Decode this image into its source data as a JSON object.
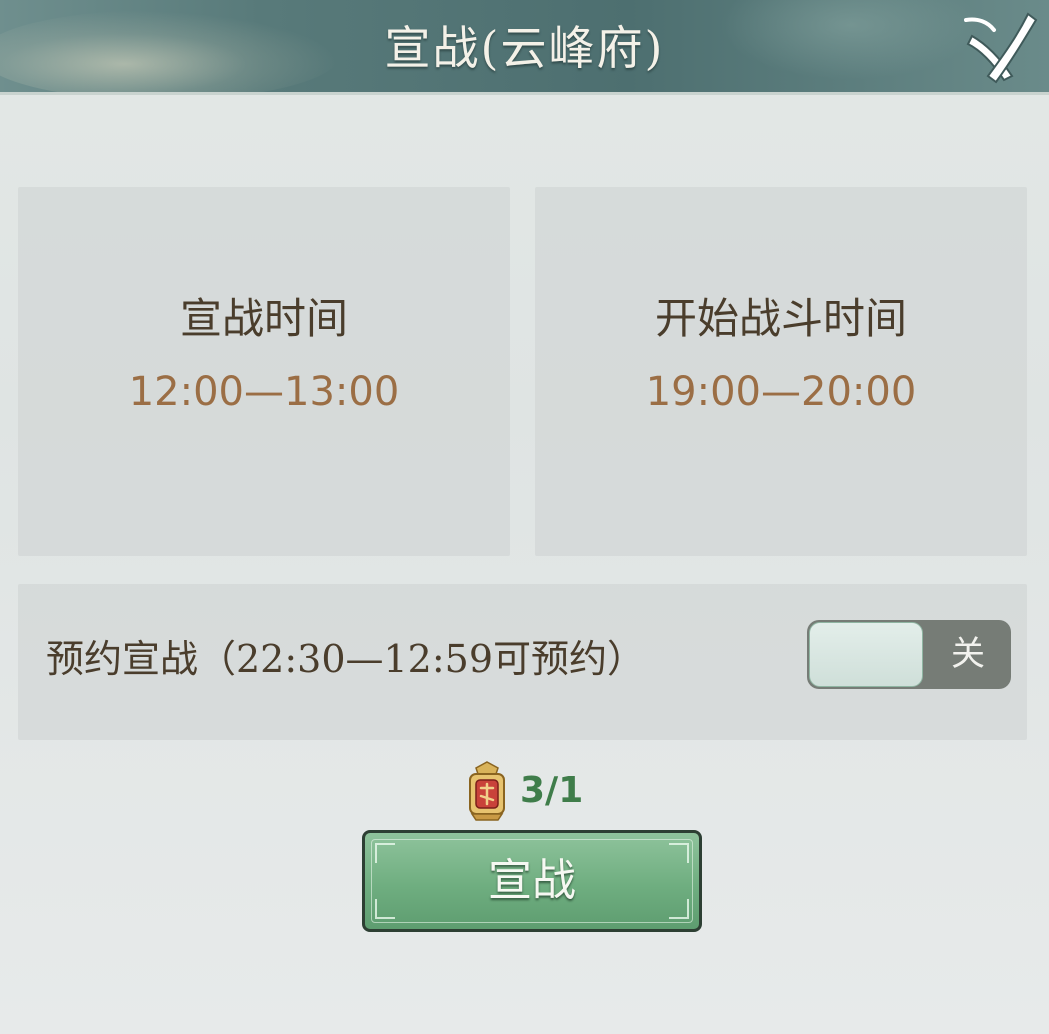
{
  "header": {
    "title": "宣战(云峰府)",
    "close_icon": "close-x-icon"
  },
  "schedule": {
    "declare": {
      "label": "宣战时间",
      "time": "12:00—13:00"
    },
    "battle": {
      "label": "开始战斗时间",
      "time": "19:00—20:00"
    }
  },
  "reservation": {
    "label": "预约宣战（22:30—12:59可预约）",
    "toggle_label": "关",
    "toggle_on": false
  },
  "cost": {
    "icon": "war-token-icon",
    "count": "3/1"
  },
  "action": {
    "declare_label": "宣战"
  },
  "colors": {
    "header_bg": "#587a7a",
    "time_text": "#9b6e45",
    "label_text": "#4a3d2c",
    "button_green": "#6fae80",
    "count_green": "#3f7d4a"
  }
}
